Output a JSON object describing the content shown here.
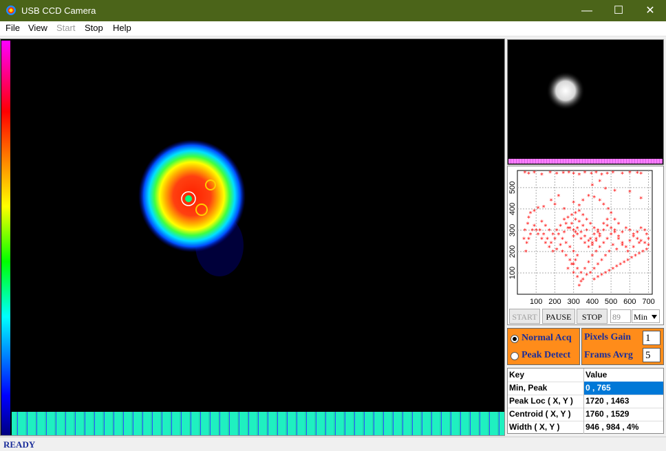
{
  "window": {
    "title": "USB CCD Camera",
    "minimize": "—",
    "maximize": "☐",
    "close": "✕"
  },
  "menu": [
    {
      "label": "File",
      "enabled": true
    },
    {
      "label": "View",
      "enabled": true
    },
    {
      "label": "Start",
      "enabled": false
    },
    {
      "label": "Stop",
      "enabled": true
    },
    {
      "label": "Help",
      "enabled": true
    }
  ],
  "controls": {
    "start_label": "START",
    "pause_label": "PAUSE",
    "stop_label": "STOP",
    "frames_value": "89",
    "unit_value": "Min"
  },
  "mode": {
    "normal": "Normal Acq",
    "peak": "Peak Detect",
    "selected": "normal"
  },
  "settings": {
    "gain_label": "Pixels Gain",
    "gain_value": "1",
    "avg_label": "Frams Avrg",
    "avg_value": "5"
  },
  "results": {
    "header_key": "Key",
    "header_value": "Value",
    "rows": [
      {
        "key": "Min, Peak",
        "value": "0 , 765"
      },
      {
        "key": "Peak Loc ( X, Y )",
        "value": "1720 , 1463"
      },
      {
        "key": "Centroid ( X, Y )",
        "value": "1760 , 1529"
      },
      {
        "key": "Width ( X, Y )",
        "value": "946 , 984 , 4%"
      }
    ]
  },
  "status": "READY",
  "chart_data": {
    "type": "scatter",
    "x_ticks": [
      "100",
      "200",
      "300",
      "400",
      "500",
      "600",
      "700"
    ],
    "y_ticks": [
      "100",
      "200",
      "300",
      "400",
      "500"
    ],
    "xlim": [
      0,
      720
    ],
    "ylim": [
      0,
      580
    ],
    "grid": true,
    "marker_color": "#ff0000",
    "points": [
      [
        40,
        570
      ],
      [
        60,
        565
      ],
      [
        90,
        570
      ],
      [
        130,
        560
      ],
      [
        175,
        570
      ],
      [
        210,
        565
      ],
      [
        245,
        568
      ],
      [
        275,
        570
      ],
      [
        300,
        565
      ],
      [
        330,
        560
      ],
      [
        360,
        570
      ],
      [
        395,
        565
      ],
      [
        420,
        570
      ],
      [
        450,
        560
      ],
      [
        480,
        565
      ],
      [
        510,
        570
      ],
      [
        560,
        565
      ],
      [
        600,
        570
      ],
      [
        640,
        568
      ],
      [
        660,
        565
      ],
      [
        440,
        530
      ],
      [
        400,
        510
      ],
      [
        470,
        495
      ],
      [
        520,
        485
      ],
      [
        600,
        480
      ],
      [
        660,
        450
      ],
      [
        220,
        460
      ],
      [
        180,
        440
      ],
      [
        140,
        410
      ],
      [
        110,
        405
      ],
      [
        90,
        390
      ],
      [
        70,
        380
      ],
      [
        60,
        360
      ],
      [
        55,
        330
      ],
      [
        40,
        300
      ],
      [
        35,
        260
      ],
      [
        200,
        420
      ],
      [
        250,
        400
      ],
      [
        300,
        430
      ],
      [
        330,
        415
      ],
      [
        350,
        440
      ],
      [
        380,
        460
      ],
      [
        410,
        455
      ],
      [
        440,
        440
      ],
      [
        460,
        420
      ],
      [
        485,
        400
      ],
      [
        500,
        380
      ],
      [
        520,
        350
      ],
      [
        540,
        330
      ],
      [
        480,
        350
      ],
      [
        460,
        330
      ],
      [
        430,
        300
      ],
      [
        410,
        280
      ],
      [
        390,
        260
      ],
      [
        370,
        300
      ],
      [
        350,
        320
      ],
      [
        330,
        340
      ],
      [
        310,
        350
      ],
      [
        290,
        330
      ],
      [
        270,
        310
      ],
      [
        250,
        290
      ],
      [
        230,
        320
      ],
      [
        210,
        300
      ],
      [
        190,
        280
      ],
      [
        170,
        300
      ],
      [
        150,
        320
      ],
      [
        130,
        340
      ],
      [
        120,
        300
      ],
      [
        140,
        280
      ],
      [
        160,
        260
      ],
      [
        180,
        240
      ],
      [
        200,
        260
      ],
      [
        220,
        280
      ],
      [
        240,
        260
      ],
      [
        260,
        240
      ],
      [
        280,
        220
      ],
      [
        300,
        200
      ],
      [
        320,
        180
      ],
      [
        310,
        160
      ],
      [
        290,
        140
      ],
      [
        270,
        120
      ],
      [
        300,
        100
      ],
      [
        320,
        80
      ],
      [
        340,
        60
      ],
      [
        330,
        40
      ],
      [
        360,
        120
      ],
      [
        380,
        150
      ],
      [
        400,
        180
      ],
      [
        420,
        200
      ],
      [
        440,
        220
      ],
      [
        460,
        240
      ],
      [
        480,
        260
      ],
      [
        500,
        280
      ],
      [
        520,
        300
      ],
      [
        540,
        260
      ],
      [
        560,
        240
      ],
      [
        580,
        220
      ],
      [
        600,
        250
      ],
      [
        620,
        270
      ],
      [
        640,
        290
      ],
      [
        660,
        310
      ],
      [
        680,
        300
      ],
      [
        690,
        280
      ],
      [
        700,
        260
      ],
      [
        650,
        240
      ],
      [
        620,
        220
      ],
      [
        590,
        200
      ],
      [
        560,
        230
      ],
      [
        530,
        210
      ],
      [
        510,
        230
      ],
      [
        490,
        200
      ],
      [
        470,
        180
      ],
      [
        450,
        160
      ],
      [
        430,
        140
      ],
      [
        410,
        120
      ],
      [
        390,
        100
      ],
      [
        370,
        90
      ],
      [
        350,
        70
      ],
      [
        340,
        100
      ],
      [
        320,
        120
      ],
      [
        300,
        140
      ],
      [
        280,
        160
      ],
      [
        260,
        180
      ],
      [
        240,
        200
      ],
      [
        230,
        230
      ],
      [
        210,
        210
      ],
      [
        190,
        200
      ],
      [
        170,
        220
      ],
      [
        150,
        240
      ],
      [
        130,
        260
      ],
      [
        110,
        280
      ],
      [
        100,
        300
      ],
      [
        90,
        320
      ],
      [
        80,
        300
      ],
      [
        70,
        280
      ],
      [
        60,
        260
      ],
      [
        50,
        240
      ],
      [
        45,
        200
      ],
      [
        300,
        270
      ],
      [
        310,
        290
      ],
      [
        320,
        310
      ],
      [
        340,
        290
      ],
      [
        360,
        270
      ],
      [
        380,
        250
      ],
      [
        400,
        230
      ],
      [
        420,
        250
      ],
      [
        440,
        270
      ],
      [
        430,
        290
      ],
      [
        410,
        310
      ],
      [
        390,
        330
      ],
      [
        370,
        350
      ],
      [
        350,
        370
      ],
      [
        330,
        390
      ],
      [
        310,
        380
      ],
      [
        290,
        370
      ],
      [
        270,
        360
      ],
      [
        250,
        350
      ],
      [
        260,
        330
      ],
      [
        280,
        310
      ],
      [
        300,
        300
      ],
      [
        320,
        280
      ],
      [
        340,
        260
      ],
      [
        360,
        240
      ],
      [
        380,
        220
      ],
      [
        400,
        240
      ],
      [
        420,
        260
      ],
      [
        440,
        280
      ],
      [
        460,
        300
      ],
      [
        480,
        320
      ],
      [
        500,
        310
      ],
      [
        520,
        290
      ],
      [
        540,
        270
      ],
      [
        560,
        290
      ],
      [
        580,
        310
      ],
      [
        600,
        300
      ],
      [
        620,
        280
      ],
      [
        640,
        260
      ],
      [
        660,
        250
      ],
      [
        680,
        240
      ],
      [
        700,
        230
      ],
      [
        690,
        210
      ],
      [
        670,
        200
      ],
      [
        650,
        190
      ],
      [
        630,
        180
      ],
      [
        610,
        170
      ],
      [
        590,
        160
      ],
      [
        570,
        150
      ],
      [
        550,
        140
      ],
      [
        530,
        130
      ],
      [
        510,
        120
      ],
      [
        490,
        110
      ],
      [
        470,
        100
      ],
      [
        450,
        90
      ],
      [
        430,
        80
      ],
      [
        410,
        70
      ]
    ]
  }
}
